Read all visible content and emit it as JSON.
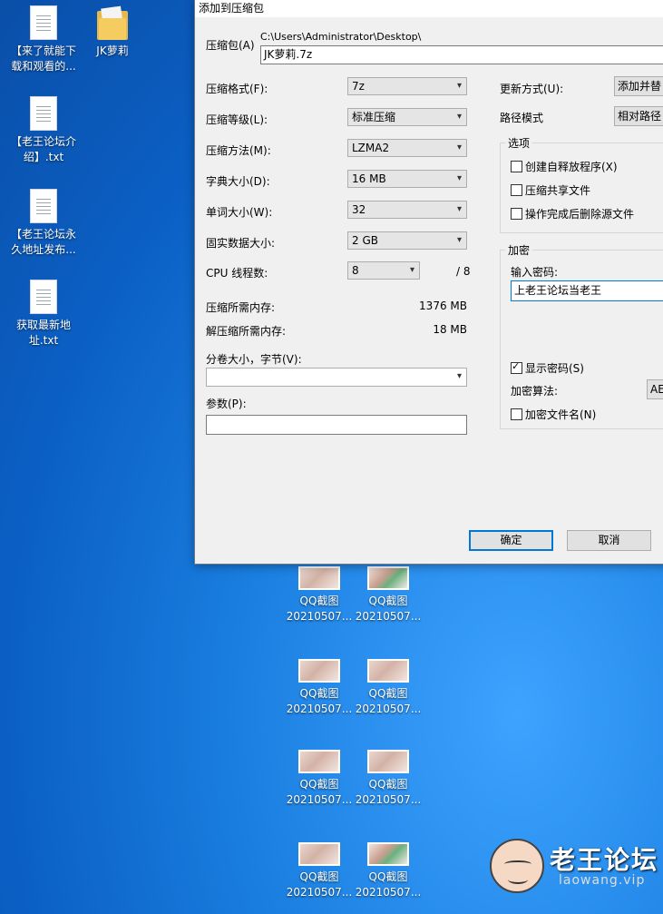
{
  "desktop": {
    "icons": [
      {
        "label": "【来了就能下载和观看的..."
      },
      {
        "label": "JK萝莉"
      },
      {
        "label": "【老王论坛介绍】.txt"
      },
      {
        "label": "【老王论坛永久地址发布..."
      },
      {
        "label": "获取最新地址.txt"
      }
    ],
    "thumbs": [
      {
        "line1": "QQ截图",
        "line2": "20210507..."
      },
      {
        "line1": "QQ截图",
        "line2": "20210507..."
      },
      {
        "line1": "QQ截图",
        "line2": "20210507..."
      },
      {
        "line1": "QQ截图",
        "line2": "20210507..."
      },
      {
        "line1": "QQ截图",
        "line2": "20210507..."
      },
      {
        "line1": "QQ截图",
        "line2": "20210507..."
      },
      {
        "line1": "QQ截图",
        "line2": "20210507..."
      },
      {
        "line1": "QQ截图",
        "line2": "20210507..."
      }
    ]
  },
  "dialog": {
    "title": "添加到压缩包",
    "archive_label": "压缩包(A)",
    "archive_path": "C:\\Users\\Administrator\\Desktop\\",
    "archive_name": "JK萝莉.7z",
    "format_label": "压缩格式(F):",
    "format_value": "7z",
    "level_label": "压缩等级(L):",
    "level_value": "标准压缩",
    "method_label": "压缩方法(M):",
    "method_value": "LZMA2",
    "dict_label": "字典大小(D):",
    "dict_value": "16 MB",
    "word_label": "单词大小(W):",
    "word_value": "32",
    "solid_label": "固实数据大小:",
    "solid_value": "2 GB",
    "cpu_label": "CPU 线程数:",
    "cpu_value": "8",
    "cpu_max": "/ 8",
    "mem_comp_label": "压缩所需内存:",
    "mem_comp_value": "1376 MB",
    "mem_decomp_label": "解压缩所需内存:",
    "mem_decomp_value": "18 MB",
    "split_label": "分卷大小，字节(V):",
    "params_label": "参数(P):",
    "update_label": "更新方式(U):",
    "update_value": "添加并替",
    "pathmode_label": "路径模式",
    "pathmode_value": "相对路径",
    "options_title": "选项",
    "opt_sfx": "创建自释放程序(X)",
    "opt_shared": "压缩共享文件",
    "opt_delete": "操作完成后删除源文件",
    "encrypt_title": "加密",
    "password_label": "输入密码:",
    "password_value": "上老王论坛当老王",
    "show_password": "显示密码(S)",
    "enc_method_label": "加密算法:",
    "enc_method_value": "AE",
    "enc_names": "加密文件名(N)",
    "ok": "确定",
    "cancel": "取消"
  },
  "watermark": {
    "title": "老王论坛",
    "subtitle": "laowang.vip"
  }
}
